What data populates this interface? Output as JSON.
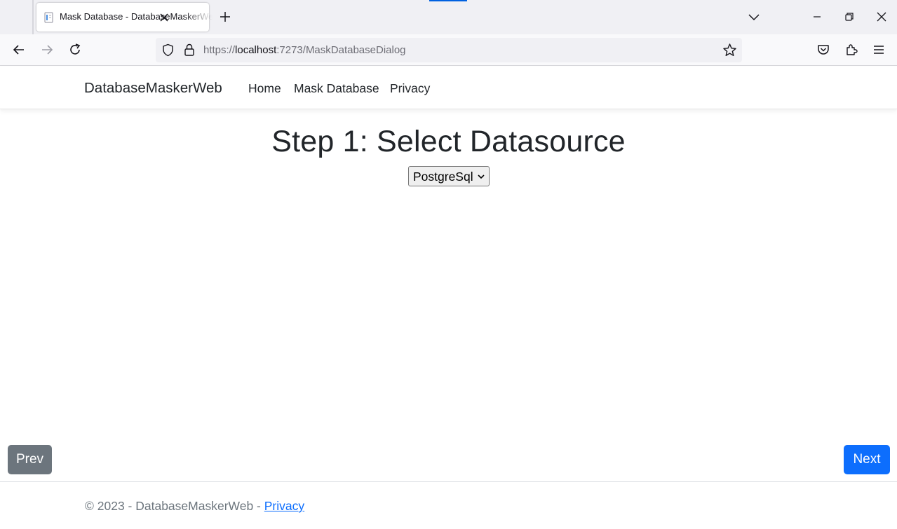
{
  "browser": {
    "tab_title": "Mask Database - DatabaseMaskerWeb",
    "url_prefix": "https://",
    "url_host": "localhost",
    "url_path": ":7273/MaskDatabaseDialog",
    "icons": [
      "page-icon",
      "close-icon",
      "plus-icon",
      "chevron-down-icon",
      "minimize-icon",
      "restore-icon",
      "window-close-icon",
      "back-arrow-icon",
      "forward-arrow-icon",
      "reload-icon",
      "shield-icon",
      "lock-icon",
      "star-icon",
      "pocket-icon",
      "extensions-icon",
      "menu-icon"
    ]
  },
  "site": {
    "brand": "DatabaseMaskerWeb",
    "nav": [
      "Home",
      "Mask Database",
      "Privacy"
    ]
  },
  "main": {
    "heading": "Step 1: Select Datasource",
    "datasource_selected": "PostgreSql",
    "prev_label": "Prev",
    "next_label": "Next"
  },
  "footer": {
    "text": "© 2023 - DatabaseMaskerWeb - ",
    "privacy_link": "Privacy"
  },
  "colors": {
    "primary": "#0d6efd",
    "secondary": "#6c757d",
    "chrome_bg": "#f0f0f4"
  }
}
